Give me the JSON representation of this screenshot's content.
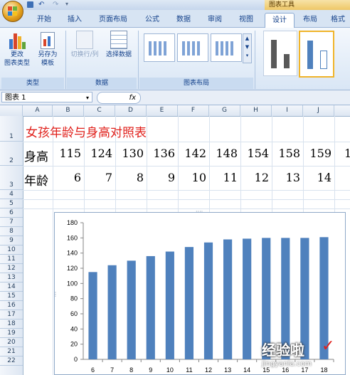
{
  "ribbon": {
    "tabs": [
      "开始",
      "插入",
      "页面布局",
      "公式",
      "数据",
      "审阅",
      "视图",
      "设计",
      "布局",
      "格式"
    ],
    "active_tab": "设计",
    "context_tools_label": "图表工具",
    "buttons": {
      "change_type": "更改\n图表类型",
      "save_template": "另存为\n模板",
      "switch_row_col": "切换行/列",
      "select_data": "选择数据"
    },
    "groups": [
      "类型",
      "数据",
      "图表布局"
    ]
  },
  "formula_bar": {
    "name_box": "图表 1",
    "fx": "fx"
  },
  "sheet": {
    "columns": [
      "A",
      "B",
      "C",
      "D",
      "E",
      "F",
      "G",
      "H",
      "I",
      "J"
    ],
    "rows": [
      "1",
      "2",
      "3",
      "4",
      "5",
      "6",
      "7",
      "8",
      "9",
      "10",
      "11",
      "12",
      "13",
      "14",
      "15",
      "16",
      "17",
      "18",
      "19",
      "20",
      "21",
      "22"
    ],
    "title": "女孩年龄与身高对照表",
    "row2_label": "身高",
    "row3_label": "年龄",
    "heights": [
      "115",
      "124",
      "130",
      "136",
      "142",
      "148",
      "154",
      "158",
      "159"
    ],
    "height_overflow": "1",
    "ages": [
      "6",
      "7",
      "8",
      "9",
      "10",
      "11",
      "12",
      "13",
      "14"
    ]
  },
  "colors": {
    "bar": "#4f81bd",
    "title_red": "#e0201b",
    "active_tab_text": "#15428b"
  },
  "watermark": {
    "brand": "经验啦",
    "url": "jingyanla.com"
  },
  "chart_data": {
    "type": "bar",
    "categories": [
      "6",
      "7",
      "8",
      "9",
      "10",
      "11",
      "12",
      "13",
      "14",
      "15",
      "16",
      "17",
      "18"
    ],
    "values": [
      115,
      124,
      130,
      136,
      142,
      148,
      154,
      158,
      159,
      160,
      160,
      160,
      161
    ],
    "ylim": [
      0,
      180
    ],
    "yticks": [
      0,
      20,
      40,
      60,
      80,
      100,
      120,
      140,
      160,
      180
    ],
    "grid": false,
    "legend": "none"
  }
}
